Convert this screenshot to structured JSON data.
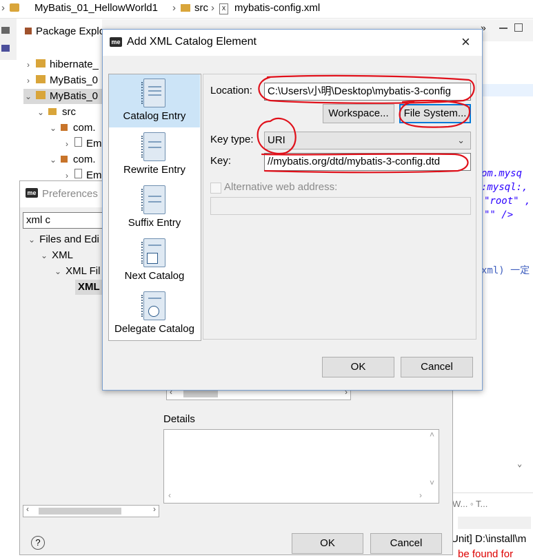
{
  "breadcrumb": {
    "project": "MyBatis_01_HellowWorld1",
    "folder": "src",
    "file": "mybatis-config.xml"
  },
  "background": {
    "package_explorer_title": "Package Explo",
    "tree": [
      {
        "label": "hibernate_",
        "indent": 1
      },
      {
        "label": "MyBatis_0",
        "indent": 1
      },
      {
        "label": "MyBatis_0",
        "indent": 1
      },
      {
        "label": "src",
        "indent": 2
      },
      {
        "label": "com.",
        "indent": 3
      },
      {
        "label": "Em",
        "indent": 4
      },
      {
        "label": "com.",
        "indent": 3
      },
      {
        "label": "Em",
        "indent": 4
      }
    ],
    "editor_snippets": [
      "om.mysq",
      ":mysql:,",
      "\"root\" ,",
      "\"\" />",
      "xml) 一定"
    ],
    "console_line": "Unit] D:\\install\\m",
    "console_red": "be found for"
  },
  "preferences": {
    "title": "Preferences",
    "filter_value": "xml c",
    "tree": [
      "Files and Edi",
      "XML",
      "XML Fil",
      "XML"
    ],
    "details_label": "Details",
    "help_icon": "?",
    "ok": "OK",
    "cancel": "Cancel"
  },
  "dialog": {
    "title": "Add XML Catalog Element",
    "close_icon": "×",
    "catalog_items": [
      {
        "label": "Catalog Entry",
        "icon": "catalog-entry-icon"
      },
      {
        "label": "Rewrite Entry",
        "icon": "rewrite-entry-icon"
      },
      {
        "label": "Suffix Entry",
        "icon": "suffix-entry-icon"
      },
      {
        "label": "Next Catalog",
        "icon": "next-catalog-icon"
      },
      {
        "label": "Delegate Catalog",
        "icon": "delegate-catalog-icon"
      }
    ],
    "location_label": "Location:",
    "location_value": "C:\\Users\\小明\\Desktop\\mybatis-3-config",
    "workspace_button": "Workspace...",
    "file_system_button": "File System...",
    "key_type_label": "Key type:",
    "key_type_value": "URI",
    "key_label": "Key:",
    "key_value": "//mybatis.org/dtd/mybatis-3-config.dtd",
    "alt_web_label": "Alternative web address:",
    "ok": "OK",
    "cancel": "Cancel",
    "accent_color": "#0078d7",
    "selected_bg": "#cce4f7",
    "annotation_color": "#e0101a"
  }
}
